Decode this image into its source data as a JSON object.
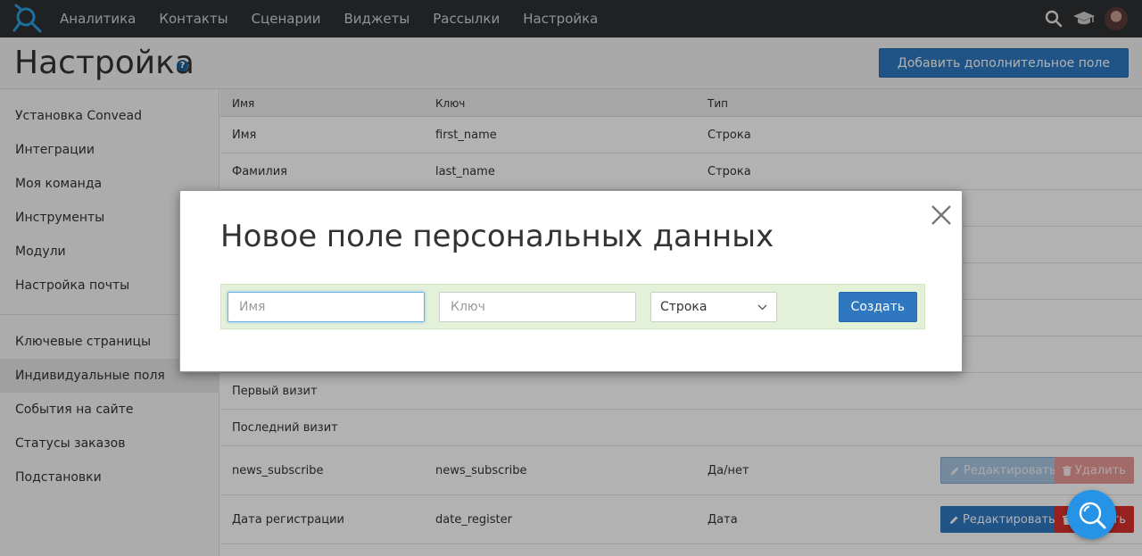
{
  "topnav": {
    "items": [
      "Аналитика",
      "Контакты",
      "Сценарии",
      "Виджеты",
      "Рассылки",
      "Настройка"
    ]
  },
  "header": {
    "title": "Настройка",
    "help_glyph": "?",
    "add_button": "Добавить дополнительное поле"
  },
  "sidebar": {
    "items": [
      "Установка Convead",
      "Интеграции",
      "Моя команда",
      "Инструменты",
      "Модули",
      "Настройка почты",
      "Ключевые страницы",
      "Индивидуальные поля",
      "События на сайте",
      "Статусы заказов",
      "Подстановки"
    ],
    "active_index": 7
  },
  "table": {
    "headers": [
      "Имя",
      "Ключ",
      "Тип"
    ],
    "rows": [
      {
        "name": "Имя",
        "key": "first_name",
        "type": "Строка"
      },
      {
        "name": "Фамилия",
        "key": "last_name",
        "type": "Строка"
      },
      {
        "name": "Первый визит",
        "key": "",
        "type": ""
      },
      {
        "name": "Последний визит",
        "key": "",
        "type": ""
      },
      {
        "name": "news_subscribe",
        "key": "news_subscribe",
        "type": "Да/нет"
      },
      {
        "name": "Дата регистрации",
        "key": "date_register",
        "type": "Дата"
      }
    ],
    "edit_label": "Редактировать",
    "delete_label": "Удалить"
  },
  "modal": {
    "title": "Новое поле персональных данных",
    "name_placeholder": "Имя",
    "key_placeholder": "Ключ",
    "type_selected": "Строка",
    "create_label": "Создать"
  },
  "colors": {
    "nav_bg": "#2e3033",
    "accent": "#2f78c0",
    "danger": "#d9302c",
    "form_bg": "#e3f1d9",
    "fab": "#2693e6"
  }
}
